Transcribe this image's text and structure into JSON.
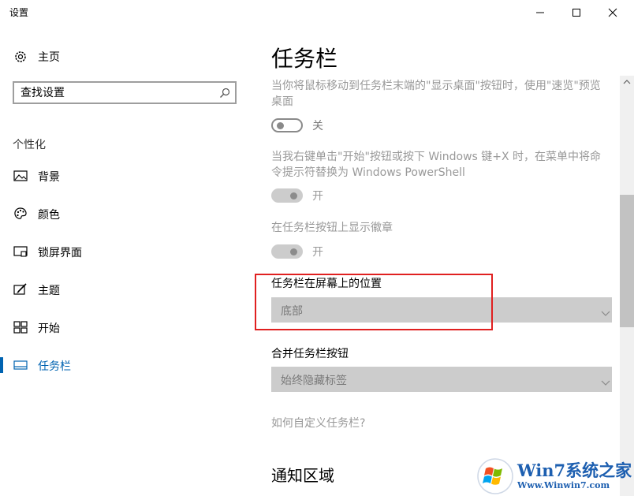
{
  "window": {
    "title": "设置"
  },
  "sidebar": {
    "home_label": "主页",
    "search_placeholder": "查找设置",
    "section_title": "个性化",
    "items": [
      {
        "label": "背景",
        "icon": "picture-icon"
      },
      {
        "label": "颜色",
        "icon": "palette-icon"
      },
      {
        "label": "锁屏界面",
        "icon": "lock-screen-icon"
      },
      {
        "label": "主题",
        "icon": "theme-brush-icon"
      },
      {
        "label": "开始",
        "icon": "start-tiles-icon"
      },
      {
        "label": "任务栏",
        "icon": "taskbar-icon",
        "selected": true
      }
    ]
  },
  "main": {
    "title": "任务栏",
    "settings": [
      {
        "description": "当你将鼠标移动到任务栏末端的\"显示桌面\"按钮时，使用\"速览\"预览桌面",
        "state": "关",
        "on": false,
        "enabled": true
      },
      {
        "description": "当我右键单击\"开始\"按钮或按下 Windows 键+X 时，在菜单中将命令提示符替换为 Windows PowerShell",
        "state": "开",
        "on": true,
        "enabled": false
      },
      {
        "description": "在任务栏按钮上显示徽章",
        "state": "开",
        "on": true,
        "enabled": false
      }
    ],
    "position": {
      "label": "任务栏在屏幕上的位置",
      "value": "底部"
    },
    "combine": {
      "label": "合并任务栏按钮",
      "value": "始终隐藏标签"
    },
    "help_link": "如何自定义任务栏?",
    "notification_title": "通知区域"
  },
  "watermark": {
    "brand": "Win7系统之家",
    "url": "Www.Winwin7.com"
  },
  "colors": {
    "accent": "#0063b1",
    "highlight_box": "#e02020",
    "disabled_text": "#999999"
  }
}
